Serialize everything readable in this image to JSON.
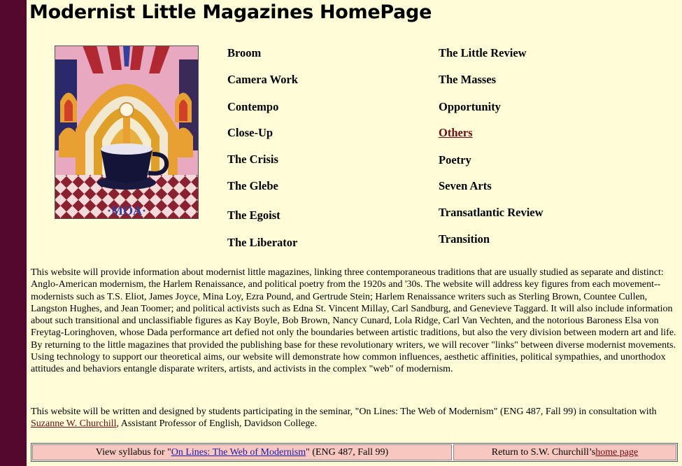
{
  "page": {
    "title": "Modernist Little Magazines HomePage"
  },
  "cover_image": {
    "alt": "magazine cover art"
  },
  "magazines": {
    "col1": [
      "Broom",
      "Camera Work",
      "Contempo",
      "Close-Up",
      "The Crisis",
      "The Glebe",
      "The Egoist",
      "The Liberator"
    ],
    "col2": [
      "The Little Review",
      "The Masses",
      "Opportunity",
      "Others",
      "Poetry",
      "Seven Arts",
      "Transatlantic Review",
      "Transition"
    ]
  },
  "intro": {
    "text": "This website will provide information about modernist little magazines, linking three contemporaneous traditions that are usually studied as separate and distinct: Anglo-American modernism, the Harlem Renaissance, and political poetry from the 1920s and '30s. The website will address key figures from each movement--modernists such as T.S. Eliot, James Joyce, Mina Loy, Ezra Pound, and Gertrude Stein; Harlem Renaissance writers such as Sterling Brown, Countee Cullen, Langston Hughes, and Jean Toomer; and political activists such as Edna St. Vincent Millay, Carl Sandburg, and Genevieve Taggard. It will also include information about such transitional and unclassifiable figures as Kay Boyle, Bob Brown, Nancy Cunard, Lola Ridge, Carl Van Vechten, and the notorious Baroness Elsa von Freytag-Loringhoven, whose Dada performance art defied not only the boundaries between artistic traditions, but also the very division between modern art and life. By returning to the little magazines that provided the publishing base for these revolutionary writers, we will recover \"links\" between diverse modernist movements. Using technology to support our theoretical aims, our website will demonstrate how common influences, aesthetic affinities, political sympathies, and unorthodox attitudes and behaviors entangle disparate writers, artists, and activists in the complex \"web\" of modernism."
  },
  "credit": {
    "text_before": "This website will be written and designed by students participating in the seminar, \"On Lines: The Web of Modernism\" (ENG 487, Fall 99) in consultation with ",
    "link": "Suzanne W. Churchill",
    "text_after": ", Assistant Professor of English, Davidson College."
  },
  "footer": {
    "syllabus_prefix": "View syllabus for \"",
    "syllabus_link": "On Lines: The Web of Modernism",
    "syllabus_suffix": "\" (ENG 487, Fall 99)",
    "return_prefix": "Return to S.W. Churchill’s ",
    "return_link": "home page"
  },
  "colors": {
    "background": "#fffdd8",
    "left_bar": "#55082e",
    "footer_cell": "#f8c8c0",
    "visited_link": "#6e0c14",
    "syllabus_link": "#1a1aa6"
  }
}
